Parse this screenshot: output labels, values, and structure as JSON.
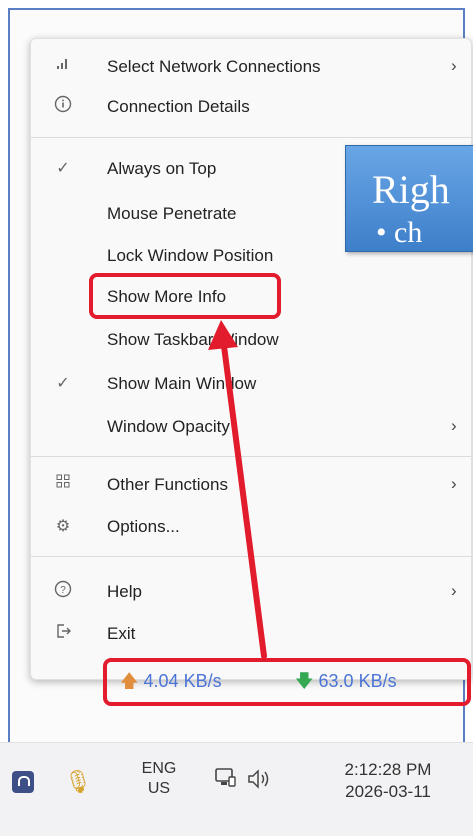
{
  "menu": {
    "items": [
      {
        "label": "Select Network Connections",
        "icon": "signal-icon",
        "arrow": "›"
      },
      {
        "label": "Connection Details",
        "icon": "info-icon",
        "arrow": ""
      },
      {
        "label": "Always on Top",
        "icon": "check-icon",
        "arrow": ""
      },
      {
        "label": "Mouse Penetrate",
        "icon": "",
        "arrow": ""
      },
      {
        "label": "Lock Window Position",
        "icon": "",
        "arrow": ""
      },
      {
        "label": "Show More Info",
        "icon": "",
        "arrow": ""
      },
      {
        "label": "Show Taskbar Window",
        "icon": "",
        "arrow": ""
      },
      {
        "label": "Show Main Window",
        "icon": "check-icon",
        "arrow": ""
      },
      {
        "label": "Window Opacity",
        "icon": "",
        "arrow": "›"
      },
      {
        "label": "Other Functions",
        "icon": "grid-icon",
        "arrow": "›"
      },
      {
        "label": "Options...",
        "icon": "gear-icon",
        "arrow": ""
      },
      {
        "label": "Help",
        "icon": "help-icon",
        "arrow": "›"
      },
      {
        "label": "Exit",
        "icon": "exit-icon",
        "arrow": ""
      }
    ]
  },
  "callout": {
    "line1": "Righ",
    "line2": "• ch"
  },
  "speed": {
    "upload": "4.04 KB/s",
    "download": "63.0 KB/s",
    "up_arrow": "🡅",
    "down_arrow": "🡇"
  },
  "taskbar": {
    "lang_line1": "ENG",
    "lang_line2": "US",
    "time": "2:12:28 PM",
    "date": "2026-03-11"
  },
  "colors": {
    "highlight": "#e21b2d",
    "speed_text": "#4a74d6",
    "callout": "#4f8fd9"
  }
}
